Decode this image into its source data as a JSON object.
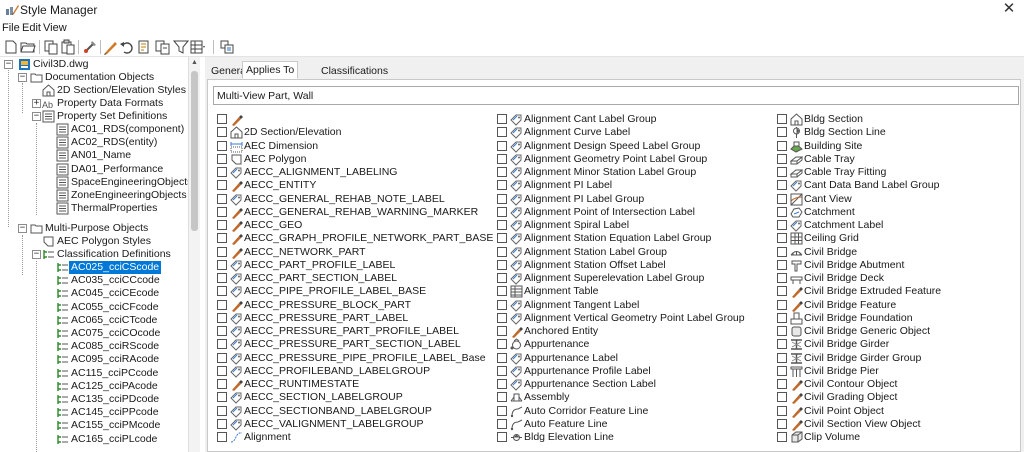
{
  "window": {
    "title": "Style Manager",
    "close_icon": "close-icon"
  },
  "menu": [
    "File",
    "Edit",
    "View"
  ],
  "toolbar": {
    "icons": [
      "new-icon",
      "open-icon",
      "copy-icon",
      "paste-icon",
      "purge-icon",
      "edit-style-icon",
      "undo-icon",
      "sort-icon",
      "copy-to-icon",
      "filter-icon",
      "view-icon",
      "toggle-view-icon"
    ]
  },
  "tree": {
    "root": "Civil3D.dwg",
    "doc_objects": "Documentation Objects",
    "section_styles": "2D Section/Elevation Styles",
    "pdf": "Property Data Formats",
    "psd": "Property Set Definitions",
    "psd_items": [
      "AC01_RDS(component)",
      "AC02_RDS(entity)",
      "AN01_Name",
      "DA01_Performance",
      "SpaceEngineeringObjects",
      "ZoneEngineeringObjects",
      "ThermalProperties"
    ],
    "multi_purpose": "Multi-Purpose Objects",
    "aec_polygon_styles": "AEC Polygon Styles",
    "class_defs": "Classification Definitions",
    "class_items": [
      "AC025_cciCScode",
      "AC035_cciCCcode",
      "AC045_cciCEcode",
      "AC055_cciCFcode",
      "AC065_cciCTcode",
      "AC075_cciCOcode",
      "AC085_cciRScode",
      "AC095_cciRAcode",
      "AC115_cciPCcode",
      "AC125_cciPAcode",
      "AC135_cciPDcode",
      "AC145_cciPPcode",
      "AC155_cciPMcode",
      "AC165_cciPLcode"
    ],
    "selected_index": 0
  },
  "tabs": [
    "General",
    "Applies To",
    "Classifications"
  ],
  "active_tab": 1,
  "object_type_text": "Multi-View Part, Wall",
  "columns": [
    [
      {
        "label": "",
        "icon": "brush"
      },
      {
        "label": "2D Section/Elevation",
        "icon": "house"
      },
      {
        "label": "AEC Dimension",
        "icon": "dim"
      },
      {
        "label": "AEC Polygon",
        "icon": "polygon"
      },
      {
        "label": "AECC_ALIGNMENT_LABELING",
        "icon": "tag"
      },
      {
        "label": "AECC_ENTITY",
        "icon": "brush"
      },
      {
        "label": "AECC_GENERAL_REHAB_NOTE_LABEL",
        "icon": "tag"
      },
      {
        "label": "AECC_GENERAL_REHAB_WARNING_MARKER",
        "icon": "brush"
      },
      {
        "label": "AECC_GEO",
        "icon": "brush"
      },
      {
        "label": "AECC_GRAPH_PROFILE_NETWORK_PART_BASE",
        "icon": "brush"
      },
      {
        "label": "AECC_NETWORK_PART",
        "icon": "brush"
      },
      {
        "label": "AECC_PART_PROFILE_LABEL",
        "icon": "tag"
      },
      {
        "label": "AECC_PART_SECTION_LABEL",
        "icon": "tag"
      },
      {
        "label": "AECC_PIPE_PROFILE_LABEL_BASE",
        "icon": "tag"
      },
      {
        "label": "AECC_PRESSURE_BLOCK_PART",
        "icon": "brush"
      },
      {
        "label": "AECC_PRESSURE_PART_LABEL",
        "icon": "tag"
      },
      {
        "label": "AECC_PRESSURE_PART_PROFILE_LABEL",
        "icon": "tag"
      },
      {
        "label": "AECC_PRESSURE_PART_SECTION_LABEL",
        "icon": "tag"
      },
      {
        "label": "AECC_PRESSURE_PIPE_PROFILE_LABEL_Base",
        "icon": "tag"
      },
      {
        "label": "AECC_PROFILEBAND_LABELGROUP",
        "icon": "tag"
      },
      {
        "label": "AECC_RUNTIMESTATE",
        "icon": "brush"
      },
      {
        "label": "AECC_SECTION_LABELGROUP",
        "icon": "tag"
      },
      {
        "label": "AECC_SECTIONBAND_LABELGROUP",
        "icon": "tag"
      },
      {
        "label": "AECC_VALIGNMENT_LABELGROUP",
        "icon": "tag"
      },
      {
        "label": "Alignment",
        "icon": "alignment"
      }
    ],
    [
      {
        "label": "Alignment Cant Label Group",
        "icon": "tag"
      },
      {
        "label": "Alignment Curve Label",
        "icon": "tag"
      },
      {
        "label": "Alignment Design Speed Label Group",
        "icon": "tag"
      },
      {
        "label": "Alignment Geometry Point Label Group",
        "icon": "tag"
      },
      {
        "label": "Alignment Minor Station Label Group",
        "icon": "tag"
      },
      {
        "label": "Alignment PI Label",
        "icon": "tag"
      },
      {
        "label": "Alignment PI Label Group",
        "icon": "tag"
      },
      {
        "label": "Alignment Point of Intersection Label",
        "icon": "tag"
      },
      {
        "label": "Alignment Spiral Label",
        "icon": "tag"
      },
      {
        "label": "Alignment Station Equation Label Group",
        "icon": "tag"
      },
      {
        "label": "Alignment Station Label Group",
        "icon": "tag"
      },
      {
        "label": "Alignment Station Offset Label",
        "icon": "tag"
      },
      {
        "label": "Alignment Superelevation Label Group",
        "icon": "tag"
      },
      {
        "label": "Alignment Table",
        "icon": "table"
      },
      {
        "label": "Alignment Tangent Label",
        "icon": "tag"
      },
      {
        "label": "Alignment Vertical Geometry Point Label Group",
        "icon": "tag"
      },
      {
        "label": "Anchored Entity",
        "icon": "brush"
      },
      {
        "label": "Appurtenance",
        "icon": "appurtenance"
      },
      {
        "label": "Appurtenance Label",
        "icon": "tag"
      },
      {
        "label": "Appurtenance Profile Label",
        "icon": "tag"
      },
      {
        "label": "Appurtenance Section Label",
        "icon": "tag"
      },
      {
        "label": "Assembly",
        "icon": "assembly"
      },
      {
        "label": "Auto Corridor Feature Line",
        "icon": "featureline"
      },
      {
        "label": "Auto Feature Line",
        "icon": "featureline"
      },
      {
        "label": "Bldg Elevation Line",
        "icon": "elevline"
      }
    ],
    [
      {
        "label": "Bldg Section",
        "icon": "house"
      },
      {
        "label": "Bldg Section Line",
        "icon": "sectionline"
      },
      {
        "label": "Building Site",
        "icon": "site"
      },
      {
        "label": "Cable Tray",
        "icon": "cabletray"
      },
      {
        "label": "Cable Tray Fitting",
        "icon": "cabletray"
      },
      {
        "label": "Cant Data Band Label Group",
        "icon": "tag"
      },
      {
        "label": "Cant View",
        "icon": "cantview"
      },
      {
        "label": "Catchment",
        "icon": "catchment"
      },
      {
        "label": "Catchment Label",
        "icon": "tag"
      },
      {
        "label": "Ceiling Grid",
        "icon": "grid"
      },
      {
        "label": "Civil Bridge",
        "icon": "bridge"
      },
      {
        "label": "Civil Bridge Abutment",
        "icon": "abutment"
      },
      {
        "label": "Civil Bridge Deck",
        "icon": "deck"
      },
      {
        "label": "Civil Bridge Extruded Feature",
        "icon": "brush"
      },
      {
        "label": "Civil Bridge Feature",
        "icon": "brush"
      },
      {
        "label": "Civil Bridge Foundation",
        "icon": "foundation"
      },
      {
        "label": "Civil Bridge Generic Object",
        "icon": "generic"
      },
      {
        "label": "Civil Bridge Girder",
        "icon": "girder"
      },
      {
        "label": "Civil Bridge Girder Group",
        "icon": "girder"
      },
      {
        "label": "Civil Bridge Pier",
        "icon": "pier"
      },
      {
        "label": "Civil Contour Object",
        "icon": "brush"
      },
      {
        "label": "Civil Grading Object",
        "icon": "brush"
      },
      {
        "label": "Civil Point Object",
        "icon": "brush"
      },
      {
        "label": "Civil Section View Object",
        "icon": "brush"
      },
      {
        "label": "Clip Volume",
        "icon": "clip"
      }
    ]
  ]
}
